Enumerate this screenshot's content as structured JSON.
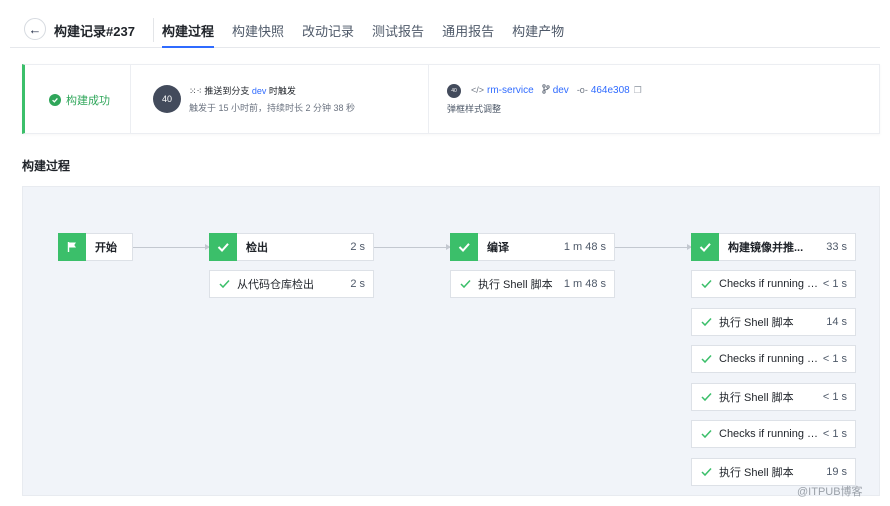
{
  "header": {
    "back_icon": "arrow-left-icon",
    "title": "构建记录#237",
    "tabs": [
      {
        "label": "构建过程",
        "active": true
      },
      {
        "label": "构建快照",
        "active": false
      },
      {
        "label": "改动记录",
        "active": false
      },
      {
        "label": "测试报告",
        "active": false
      },
      {
        "label": "通用报告",
        "active": false
      },
      {
        "label": "构建产物",
        "active": false
      }
    ]
  },
  "status": {
    "label": "构建成功",
    "color": "#2fa65a",
    "avatar_text": "40",
    "trigger_user": "⁙⁖",
    "trigger_pre": "推送到分支",
    "trigger_branch": "dev",
    "trigger_post": "时触发",
    "trigger_detail": "触发于 15 小时前，持续时长 2 分钟 38 秒",
    "repo_avatar_text": "40",
    "repo_name": "rm-service",
    "branch": "dev",
    "commit": "464e308",
    "commit_message": "弹框样式调整"
  },
  "section_title": "构建过程",
  "pipeline": {
    "start_label": "开始",
    "stages": [
      {
        "name": "检出",
        "time": "2 s",
        "steps": [
          {
            "name": "从代码仓库检出",
            "time": "2 s"
          }
        ]
      },
      {
        "name": "编译",
        "time": "1 m 48 s",
        "steps": [
          {
            "name": "执行 Shell 脚本",
            "time": "1 m 48 s"
          }
        ]
      },
      {
        "name": "构建镜像并推...",
        "time": "33 s",
        "steps": [
          {
            "name": "Checks if running o...",
            "time": "< 1 s"
          },
          {
            "name": "执行 Shell 脚本",
            "time": "14 s"
          },
          {
            "name": "Checks if running o...",
            "time": "< 1 s"
          },
          {
            "name": "执行 Shell 脚本",
            "time": "< 1 s"
          },
          {
            "name": "Checks if running o...",
            "time": "< 1 s"
          },
          {
            "name": "执行 Shell 脚本",
            "time": "19 s"
          }
        ]
      }
    ]
  },
  "watermark": "@ITPUB博客"
}
